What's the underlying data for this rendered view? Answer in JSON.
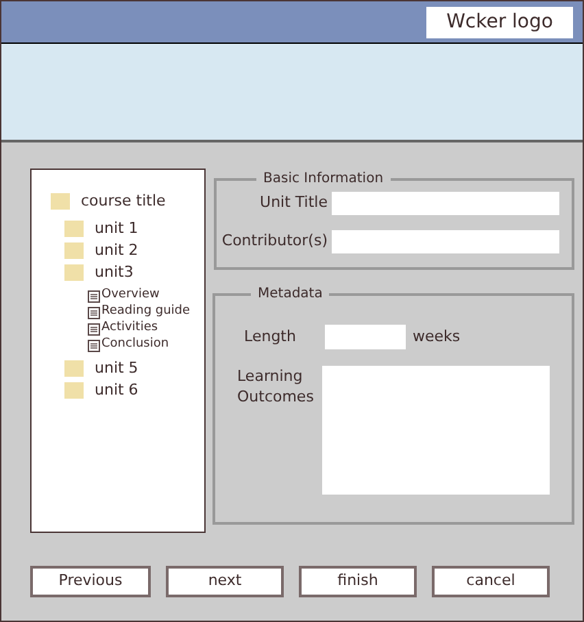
{
  "header": {
    "logo": "Wcker logo"
  },
  "tree": [
    {
      "label": "course title",
      "kind": "folder",
      "children": [
        {
          "label": "unit 1",
          "kind": "folder"
        },
        {
          "label": "unit 2",
          "kind": "folder"
        },
        {
          "label": "unit3",
          "kind": "folder",
          "children": [
            {
              "label": "Overview",
              "kind": "page"
            },
            {
              "label": "Reading guide",
              "kind": "page"
            },
            {
              "label": "Activities",
              "kind": "page"
            },
            {
              "label": "Conclusion",
              "kind": "page"
            }
          ]
        },
        {
          "label": "unit 5",
          "kind": "folder"
        },
        {
          "label": "unit 6",
          "kind": "folder"
        }
      ]
    }
  ],
  "basic_information": {
    "title": "Basic Information",
    "fields": [
      {
        "label": "Unit Title"
      },
      {
        "label": "Contributor(s)"
      }
    ]
  },
  "metadata": {
    "title": "Metadata",
    "length": {
      "label": "Length",
      "unit": "weeks"
    },
    "learning_outcomes": {
      "label": "Learning\nOutcomes"
    }
  },
  "buttons": [
    "Previous",
    "next",
    "finish",
    "cancel"
  ]
}
